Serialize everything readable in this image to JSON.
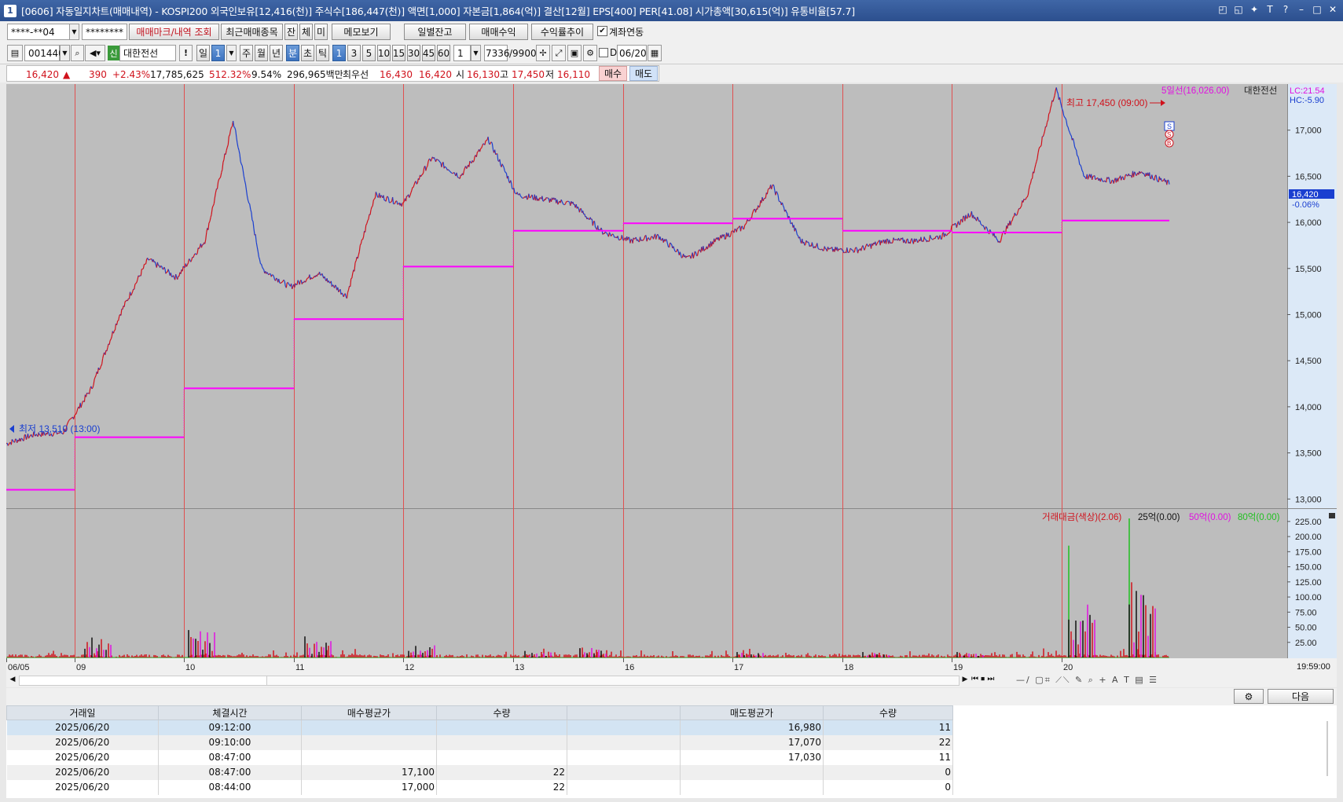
{
  "title": "[0606] 자동일지차트(매매내역) - KOSPI200 외국인보유[12,416(천)] 주식수[186,447(천)] 액면[1,000] 자본금[1,864(억)] 결산[12월] EPS[400] PER[41.08] 시가총액[30,615(억)] 유통비율[57.7]",
  "toolbar1": {
    "account": "****-**04",
    "password": "********",
    "btn_trade_mark": "매매마크/내역 조회",
    "btn_recent": "최근매매종목",
    "btn_jan": "잔",
    "btn_che": "체",
    "btn_mi": "미",
    "btn_memo": "메모보기",
    "btn_daily": "일별잔고",
    "btn_profit": "매매수익",
    "btn_rate": "수익률추이",
    "acct_link_check": "✔",
    "acct_link": "계좌연동"
  },
  "toolbar2": {
    "code": "001440",
    "sin_badge": "신",
    "stock_name": "대한전선",
    "alert": "!",
    "period_day": "일",
    "period_num": "1",
    "week": "주",
    "month": "월",
    "year": "년",
    "minute": "분",
    "second": "초",
    "tick": "틱",
    "intervals": [
      "1",
      "3",
      "5",
      "10",
      "15",
      "30",
      "45",
      "60"
    ],
    "unit": "1",
    "count": "7336",
    "max_count": "/9900",
    "d_label": "D",
    "date": "06/20"
  },
  "quote": {
    "price": "16,420",
    "arrow": "▲",
    "change": "390",
    "change_pct": "+2.43%",
    "volume": "17,785,625",
    "vol_ratio": "512.32%",
    "turnover": "9.54%",
    "amount": "296,965백만",
    "bid_label": "최우선",
    "bid": "16,430",
    "ask": "16,420",
    "open_label": "시",
    "open": "16,130",
    "high_label": "고",
    "high": "17,450",
    "low_label": "저",
    "low": "16,110",
    "buy_btn": "매수",
    "sell_btn": "매도"
  },
  "chart_data": [
    {
      "type": "line",
      "indicators": {
        "ma5_label": "5일선(16,026.00)",
        "stock_tag": "대한전선",
        "lc": "LC:21.54",
        "hc": "HC:-5.90",
        "current_price": "16,420",
        "current_pct": "-0.06%",
        "high_annotation": "최고 17,450 (09:00)",
        "low_annotation": "최저 13,510 (13:00)",
        "trade_marks": [
          "S",
          "S",
          "B"
        ]
      },
      "y_ticks": [
        13000,
        13500,
        14000,
        14500,
        15000,
        15500,
        16000,
        16500,
        17000
      ],
      "y_tick_labels": [
        "13,000",
        "13,500",
        "14,000",
        "14,500",
        "15,000",
        "15,500",
        "16,000",
        "16,500",
        "17,000"
      ],
      "ylim": [
        12900,
        17500
      ],
      "x_categories": [
        "06/05",
        "09",
        "10",
        "11",
        "12",
        "13",
        "16",
        "17",
        "18",
        "19",
        "20"
      ],
      "time_label": "19:59:00",
      "series": [
        {
          "kind": "price",
          "values": [
            13600,
            13700,
            13720,
            14200,
            15000,
            15600,
            15400,
            15800,
            17100,
            15500,
            15300,
            15450,
            15200,
            16300,
            16200,
            16700,
            16500,
            16900,
            16300,
            16250,
            16200,
            15900,
            15800,
            15850,
            15600,
            15800,
            15950,
            16400,
            15800,
            15700,
            15700,
            15800,
            15800,
            15850,
            16100,
            15800,
            16300,
            17450,
            16500,
            16450,
            16550,
            16420
          ]
        },
        {
          "kind": "ma5",
          "values": [
            13100,
            13670,
            14200,
            14950,
            15520,
            15910,
            15990,
            16040,
            15910,
            15890,
            16020
          ]
        }
      ]
    },
    {
      "type": "bar",
      "indicators": {
        "amount_label": "거래대금(색상)(2.06)",
        "level1": "25억(0.00)",
        "level2": "50억(0.00)",
        "level3": "80억(0.00)"
      },
      "y_ticks": [
        25,
        50,
        75,
        100,
        125,
        150,
        175,
        200,
        225
      ],
      "y_tick_labels": [
        "25.00",
        "50.00",
        "75.00",
        "100.00",
        "125.00",
        "150.00",
        "175.00",
        "200.00",
        "225.00"
      ],
      "ylim": [
        0,
        230
      ],
      "peaks": [
        {
          "day": "09",
          "value": 60
        },
        {
          "day": "10",
          "value": 80
        },
        {
          "day": "11",
          "value": 58
        },
        {
          "day": "12",
          "value": 40
        },
        {
          "day": "13",
          "value": 18
        },
        {
          "day": "16",
          "value": 30
        },
        {
          "day": "17",
          "value": 15
        },
        {
          "day": "18",
          "value": 15
        },
        {
          "day": "19",
          "value": 15
        },
        {
          "day": "20",
          "value": 185
        },
        {
          "day": "20b",
          "value": 230
        }
      ]
    }
  ],
  "bottom": {
    "settings_icon": "gear-icon",
    "next_btn": "다음"
  },
  "table": {
    "headers": [
      "거래일",
      "체결시간",
      "매수평균가",
      "수량",
      "",
      "매도평균가",
      "수량"
    ],
    "rows": [
      [
        "2025/06/20",
        "09:12:00",
        "",
        "",
        "",
        "16,980",
        "11"
      ],
      [
        "2025/06/20",
        "09:10:00",
        "",
        "",
        "",
        "17,070",
        "22"
      ],
      [
        "2025/06/20",
        "08:47:00",
        "",
        "",
        "",
        "17,030",
        "11"
      ],
      [
        "2025/06/20",
        "08:47:00",
        "17,100",
        "22",
        "",
        "",
        "0"
      ],
      [
        "2025/06/20",
        "08:44:00",
        "17,000",
        "22",
        "",
        "",
        "0"
      ]
    ]
  },
  "colors": {
    "up": "#d0121c",
    "down": "#1a3fd0",
    "ma": "#ff00ff",
    "chart_bg": "#bdbdbd",
    "axis_bg": "#dce9f7"
  }
}
